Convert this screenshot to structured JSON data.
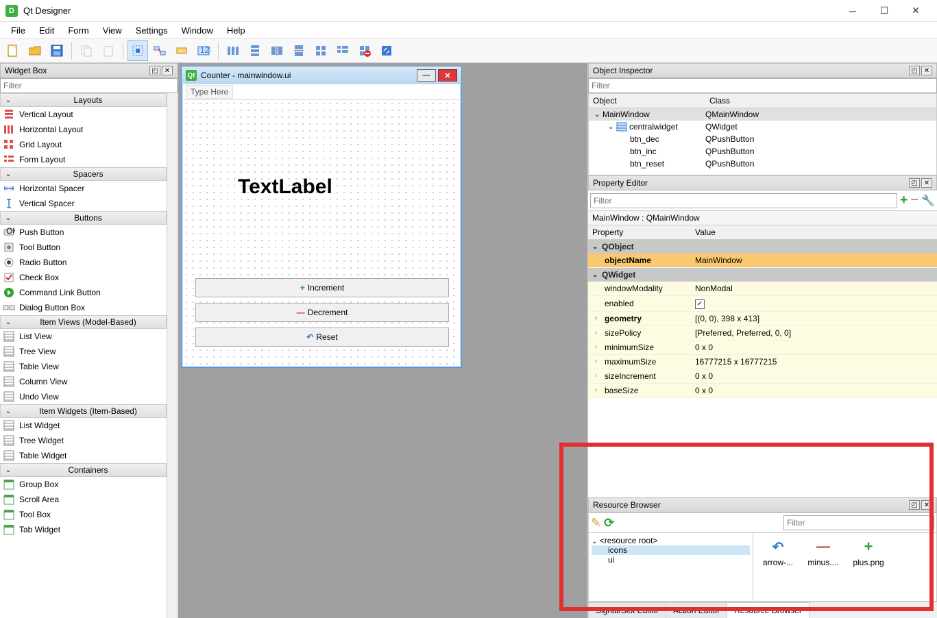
{
  "window": {
    "title": "Qt Designer"
  },
  "menu": [
    "File",
    "Edit",
    "Form",
    "View",
    "Settings",
    "Window",
    "Help"
  ],
  "widget_box": {
    "title": "Widget Box",
    "filter_placeholder": "Filter",
    "categories": [
      {
        "name": "Layouts",
        "items": [
          "Vertical Layout",
          "Horizontal Layout",
          "Grid Layout",
          "Form Layout"
        ]
      },
      {
        "name": "Spacers",
        "items": [
          "Horizontal Spacer",
          "Vertical Spacer"
        ]
      },
      {
        "name": "Buttons",
        "items": [
          "Push Button",
          "Tool Button",
          "Radio Button",
          "Check Box",
          "Command Link Button",
          "Dialog Button Box"
        ]
      },
      {
        "name": "Item Views (Model-Based)",
        "items": [
          "List View",
          "Tree View",
          "Table View",
          "Column View",
          "Undo View"
        ]
      },
      {
        "name": "Item Widgets (Item-Based)",
        "items": [
          "List Widget",
          "Tree Widget",
          "Table Widget"
        ]
      },
      {
        "name": "Containers",
        "items": [
          "Group Box",
          "Scroll Area",
          "Tool Box",
          "Tab Widget"
        ]
      }
    ]
  },
  "form": {
    "title": "Counter - mainwindow.ui",
    "menuhint": "Type Here",
    "label": "TextLabel",
    "buttons": [
      {
        "icon": "plus",
        "label": "Increment"
      },
      {
        "icon": "minus",
        "label": "Decrement"
      },
      {
        "icon": "undo",
        "label": "Reset"
      }
    ]
  },
  "object_inspector": {
    "title": "Object Inspector",
    "filter_placeholder": "Filter",
    "headers": [
      "Object",
      "Class"
    ],
    "rows": [
      {
        "indent": 0,
        "expand": "v",
        "name": "MainWindow",
        "class": "QMainWindow",
        "sel": true
      },
      {
        "indent": 1,
        "expand": "v",
        "name": "centralwidget",
        "class": "QWidget"
      },
      {
        "indent": 2,
        "name": "btn_dec",
        "class": "QPushButton"
      },
      {
        "indent": 2,
        "name": "btn_inc",
        "class": "QPushButton"
      },
      {
        "indent": 2,
        "name": "btn_reset",
        "class": "QPushButton"
      }
    ]
  },
  "property_editor": {
    "title": "Property Editor",
    "filter_placeholder": "Filter",
    "context": "MainWindow : QMainWindow",
    "headers": [
      "Property",
      "Value"
    ],
    "groups": [
      {
        "name": "QObject",
        "rows": [
          {
            "name": "objectName",
            "value": "MainWindow",
            "bold": true,
            "on": true
          }
        ]
      },
      {
        "name": "QWidget",
        "rows": [
          {
            "name": "windowModality",
            "value": "NonModal"
          },
          {
            "name": "enabled",
            "value": "[check]",
            "check": true
          },
          {
            "name": "geometry",
            "value": "[(0, 0), 398 x 413]",
            "bold": true,
            "exp": true
          },
          {
            "name": "sizePolicy",
            "value": "[Preferred, Preferred, 0, 0]",
            "exp": true
          },
          {
            "name": "minimumSize",
            "value": "0 x 0",
            "exp": true
          },
          {
            "name": "maximumSize",
            "value": "16777215 x 16777215",
            "exp": true
          },
          {
            "name": "sizeIncrement",
            "value": "0 x 0",
            "exp": true
          },
          {
            "name": "baseSize",
            "value": "0 x 0",
            "exp": true
          }
        ]
      }
    ]
  },
  "resource_browser": {
    "title": "Resource Browser",
    "filter_placeholder": "Filter",
    "tree": {
      "root": "<resource root>",
      "items": [
        "icons",
        "ui"
      ],
      "selected": "icons"
    },
    "icons": [
      {
        "name": "arrow-...",
        "type": "undo"
      },
      {
        "name": "minus....",
        "type": "minus"
      },
      {
        "name": "plus.png",
        "type": "plus"
      }
    ],
    "tabs": [
      "Signal/Slot Editor",
      "Action Editor",
      "Resource Browser"
    ],
    "active_tab": 2
  }
}
